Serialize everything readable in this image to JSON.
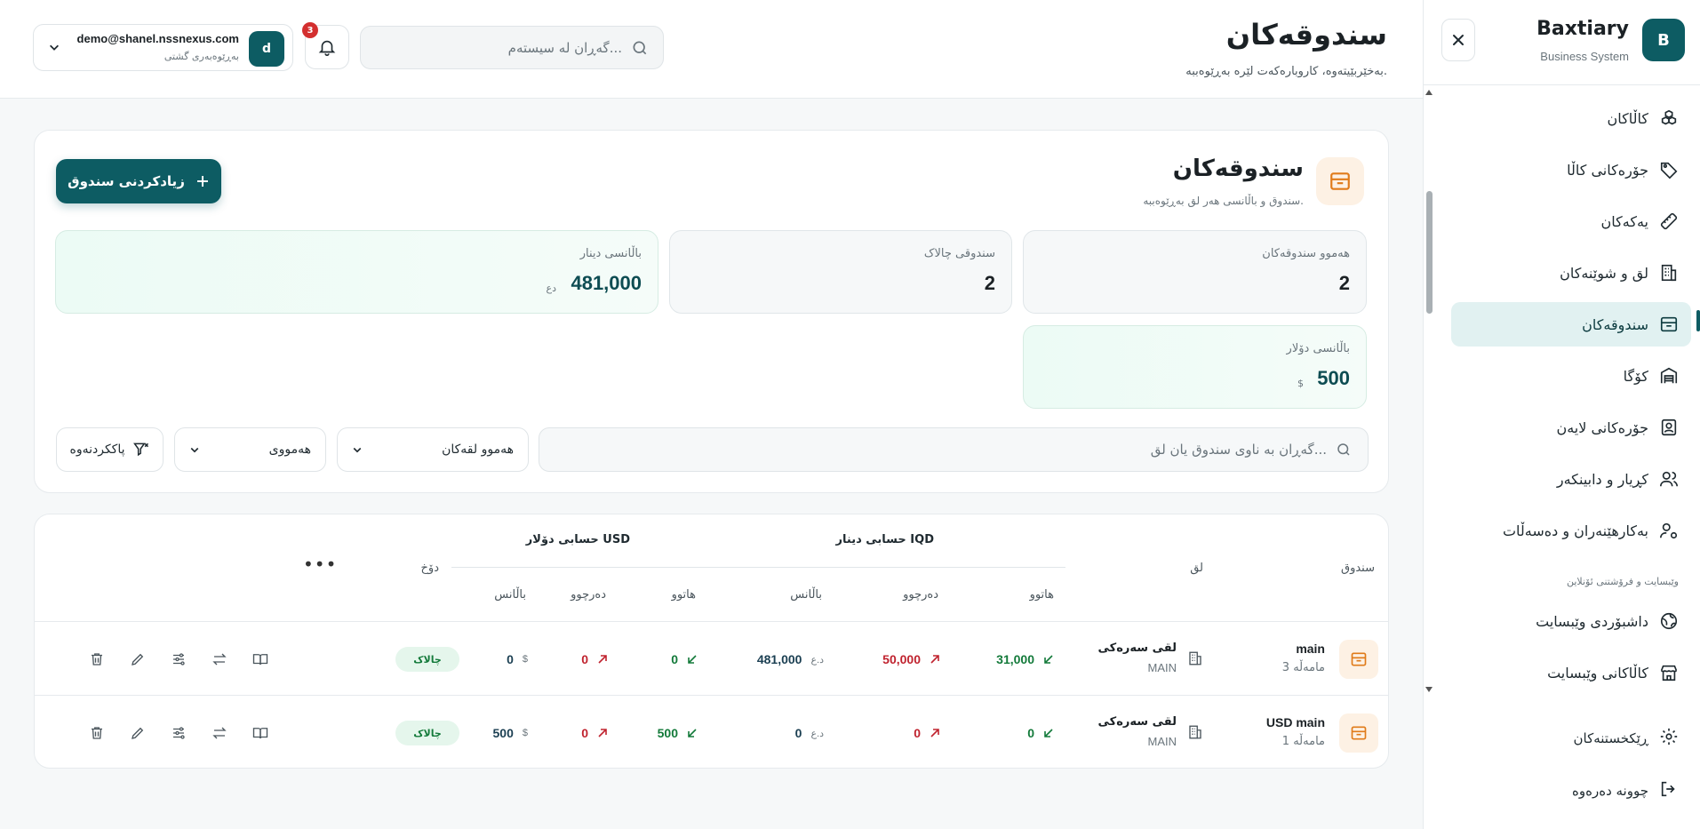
{
  "brand": {
    "name": "Baxtiary",
    "subtitle": "Business System",
    "logo_letter": "B"
  },
  "sidebar": {
    "items": [
      {
        "label": "کاڵاکان",
        "icon": "boxes-icon"
      },
      {
        "label": "جۆرەکانی کاڵا",
        "icon": "tag-icon"
      },
      {
        "label": "یەکەکان",
        "icon": "ruler-icon"
      },
      {
        "label": "لق و شوێنەکان",
        "icon": "building-icon"
      },
      {
        "label": "سندوقەکان",
        "icon": "safe-icon",
        "active": true
      },
      {
        "label": "کۆگا",
        "icon": "warehouse-icon"
      },
      {
        "label": "جۆرەکانی لایەن",
        "icon": "contact-icon"
      },
      {
        "label": "کڕیار و دابینکەر",
        "icon": "users-icon"
      },
      {
        "label": "بەکارهێنەران و دەسەڵات",
        "icon": "user-cog-icon"
      }
    ],
    "section_label": "وێبسایت و فرۆشتنی ئۆنلاین",
    "web_items": [
      {
        "label": "داشبۆردی وێبسایت",
        "icon": "globe-icon"
      },
      {
        "label": "کاڵاکانی وێبسایت",
        "icon": "store-icon"
      }
    ],
    "settings_label": "ڕێکخستنەکان",
    "logout_label": "چوونە دەرەوە"
  },
  "header": {
    "title": "سندوقەکان",
    "subtitle": "بەخێربێیتەوە، کاروبارەکەت لێرە بەڕێوەببە.",
    "search_placeholder": "گەڕان لە سیستەم...",
    "notifications_count": "3",
    "user": {
      "email": "demo@shanel.nssnexus.com",
      "role": "بەڕێوەبەری گشتی",
      "avatar_letter": "d"
    }
  },
  "section": {
    "title": "سندوقەکان",
    "subtitle": "سندوق و باڵانسی هەر لق بەڕێوەببە.",
    "add_button": "زیادکردنی سندوق"
  },
  "stats": {
    "total": {
      "label": "هەموو سندوقەکان",
      "value": "2"
    },
    "active": {
      "label": "سندوقی چالاک",
      "value": "2"
    },
    "iqd_balance": {
      "label": "باڵانسی دینار",
      "value": "481,000",
      "unit": "دع"
    },
    "usd_balance": {
      "label": "باڵانسی دۆلار",
      "value": "500",
      "unit": "$"
    }
  },
  "filters": {
    "search_placeholder": "گەڕان بە ناوی سندوق یان لق...",
    "branch_select": "هەموو لقەکان",
    "status_select": "هەمووی",
    "reset_button": "پاککردنەوە"
  },
  "table": {
    "headers": {
      "box": "سندوق",
      "branch": "لق",
      "iqd_group": "حسابی دینار IQD",
      "usd_group": "حسابی دۆلار USD",
      "status": "دۆخ",
      "in": "هاتوو",
      "out": "دەرچوو",
      "balance": "باڵانس"
    },
    "rows": [
      {
        "name": "main",
        "count": "3 مامەڵە",
        "branch": "لقی سەرەکی",
        "branch_code": "MAIN",
        "iqd_in": "31,000",
        "iqd_out": "50,000",
        "iqd_balance": "481,000",
        "iqd_unit": "د.ع",
        "usd_in": "0",
        "usd_out": "0",
        "usd_balance": "0",
        "usd_unit": "$",
        "status": "چالاک"
      },
      {
        "name": "USD main",
        "count": "1 مامەڵە",
        "branch": "لقی سەرەکی",
        "branch_code": "MAIN",
        "iqd_in": "0",
        "iqd_out": "0",
        "iqd_balance": "0",
        "iqd_unit": "د.ع",
        "usd_in": "500",
        "usd_out": "0",
        "usd_balance": "500",
        "usd_unit": "$",
        "status": "چالاک"
      }
    ]
  },
  "colors": {
    "primary": "#0d5c63",
    "in": "#137a3a",
    "out": "#c0232f",
    "accent_bg": "#fdf1e4",
    "badge": "#d32f2f"
  }
}
